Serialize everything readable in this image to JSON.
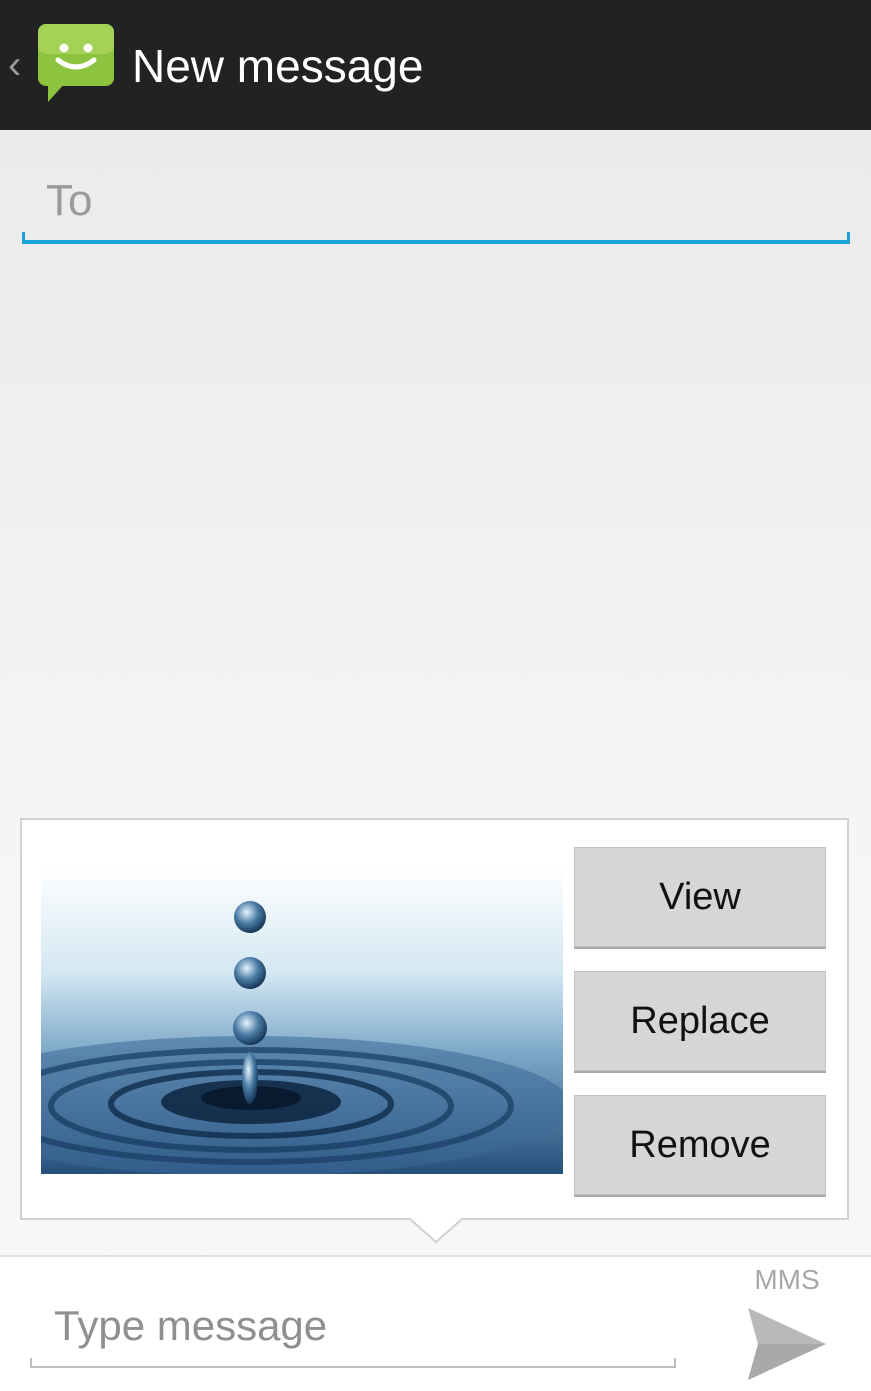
{
  "action_bar": {
    "title": "New message",
    "up_icon": "chevron-left-icon",
    "app_icon": "messaging-smiley-icon",
    "colors": {
      "background": "#222222",
      "icon_green": "#8dc43f"
    }
  },
  "recipient": {
    "placeholder": "To",
    "value": "",
    "accent_color": "#1ba1d8"
  },
  "attachment": {
    "image_description_icon": "water-drop-photo",
    "buttons": {
      "view": "View",
      "replace": "Replace",
      "remove": "Remove"
    }
  },
  "compose": {
    "placeholder": "Type message",
    "value": "",
    "mode_label": "MMS",
    "send_icon": "send-arrow-icon"
  }
}
